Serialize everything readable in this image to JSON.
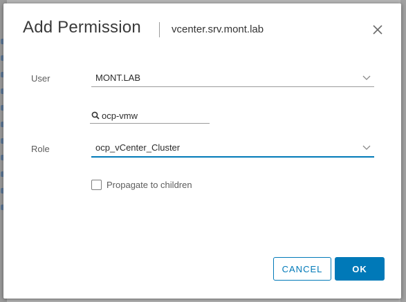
{
  "dialog": {
    "title": "Add Permission",
    "subtitle": "vcenter.srv.mont.lab"
  },
  "form": {
    "user": {
      "label": "User",
      "domain_value": "MONT.LAB"
    },
    "search": {
      "value": "ocp-vmw"
    },
    "role": {
      "label": "Role",
      "value": "ocp_vCenter_Cluster"
    },
    "propagate": {
      "label": "Propagate to children",
      "checked": false
    }
  },
  "buttons": {
    "cancel_label": "CANCEL",
    "ok_label": "OK"
  },
  "colors": {
    "accent": "#0079b8",
    "title_text": "#3a3a3a",
    "label_text": "#5c5c5c"
  },
  "icons": {
    "close": "close-icon",
    "chevron": "chevron-down-icon",
    "search": "search-icon"
  }
}
